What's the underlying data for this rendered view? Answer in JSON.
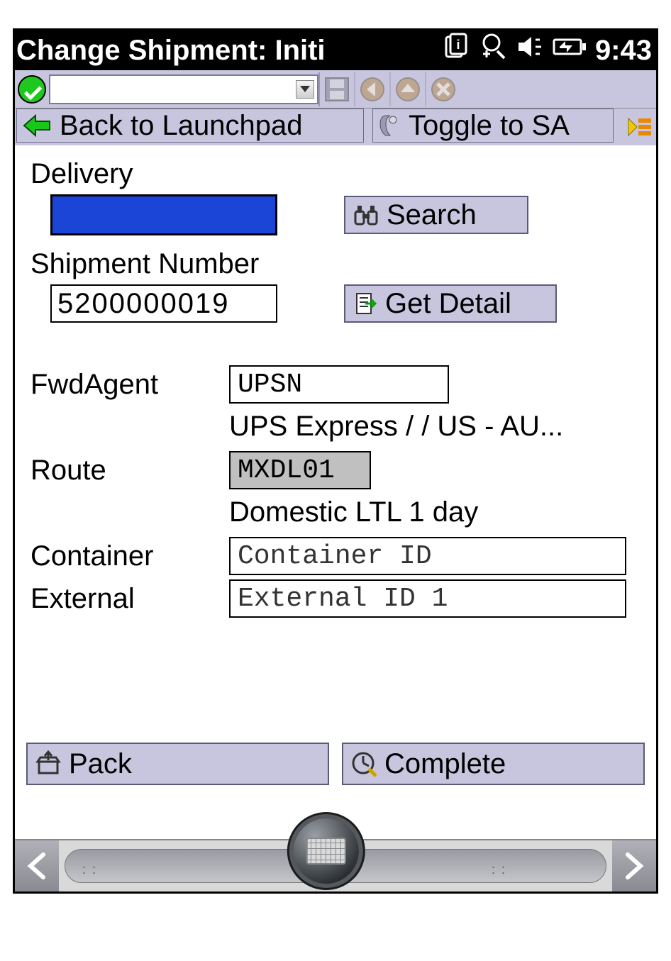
{
  "status": {
    "title": "Change Shipment: Initi",
    "clock": "9:43"
  },
  "nav": {
    "back_label": "Back to Launchpad",
    "toggle_label": "Toggle to SA"
  },
  "form": {
    "delivery_label": "Delivery",
    "delivery_value": "",
    "search_label": "Search",
    "shipment_label": "Shipment Number",
    "shipment_value": "5200000019",
    "get_detail_label": "Get Detail",
    "fwd_label": "FwdAgent",
    "fwd_value": "UPSN",
    "fwd_desc": "UPS Express /  / US  -  AU...",
    "route_label": "Route",
    "route_value": "MXDL01",
    "route_desc": "Domestic LTL 1 day",
    "container_label": "Container",
    "container_placeholder": "Container ID",
    "external_label": "External",
    "external_placeholder": "External ID 1"
  },
  "actions": {
    "pack_label": "Pack",
    "complete_label": "Complete"
  }
}
